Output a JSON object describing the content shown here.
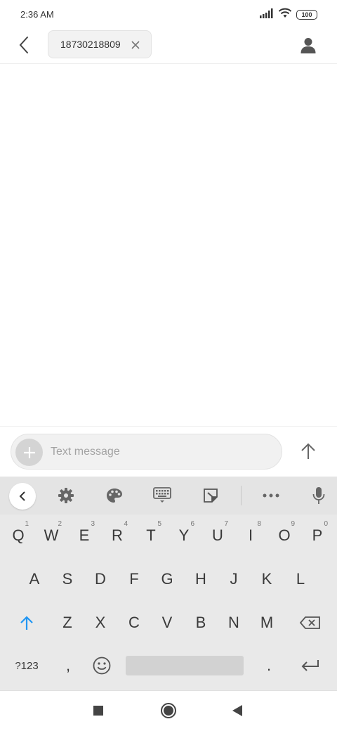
{
  "status_bar": {
    "time": "2:36 AM",
    "battery": "100",
    "icons": [
      "signal-icon",
      "wifi-icon",
      "battery-icon"
    ]
  },
  "header": {
    "back_icon": "chevron-left-icon",
    "recipient": "18730218809",
    "contact_icon": "person-icon"
  },
  "compose": {
    "placeholder": "Text message",
    "value": ""
  },
  "keyboard": {
    "toolbar": [
      "chevron-left-icon",
      "gear-icon",
      "palette-icon",
      "keyboard-icon",
      "sticky-note-icon",
      "more-icon",
      "mic-icon"
    ],
    "row1": [
      {
        "label": "Q",
        "hint": "1"
      },
      {
        "label": "W",
        "hint": "2"
      },
      {
        "label": "E",
        "hint": "3"
      },
      {
        "label": "R",
        "hint": "4"
      },
      {
        "label": "T",
        "hint": "5"
      },
      {
        "label": "Y",
        "hint": "6"
      },
      {
        "label": "U",
        "hint": "7"
      },
      {
        "label": "I",
        "hint": "8"
      },
      {
        "label": "O",
        "hint": "9"
      },
      {
        "label": "P",
        "hint": "0"
      }
    ],
    "row2": [
      "A",
      "S",
      "D",
      "F",
      "G",
      "H",
      "J",
      "K",
      "L"
    ],
    "row3": [
      "Z",
      "X",
      "C",
      "V",
      "B",
      "N",
      "M"
    ],
    "symbols_label": "?123",
    "comma": ",",
    "period": "."
  },
  "colors": {
    "accent": "#2196f3",
    "icon_gray": "#666666",
    "keyboard_bg": "#e9e9e9"
  }
}
